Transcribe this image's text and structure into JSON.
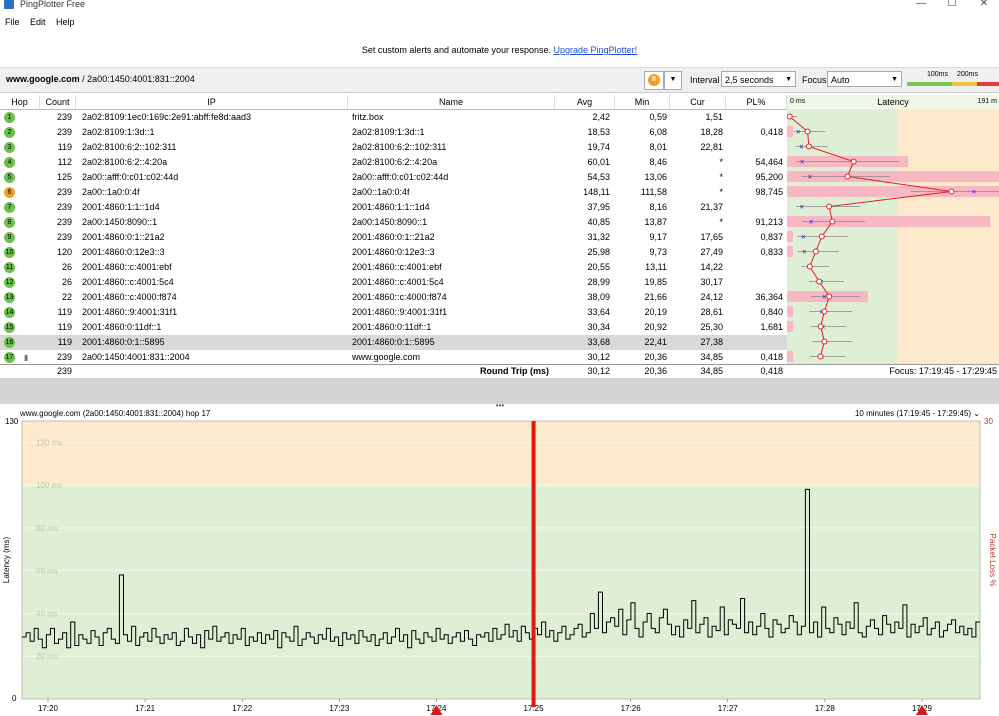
{
  "window": {
    "title": "PingPlotter Free",
    "min": "—",
    "max": "☐",
    "close": "✕"
  },
  "menu": [
    "File",
    "Edit",
    "Help"
  ],
  "banner": {
    "text": "Set custom alerts and automate your response.",
    "link": "Upgrade PingPlotter!"
  },
  "toolbar": {
    "target_host": "www.google.com",
    "target_ip": " / 2a00:1450:4001:831::2004",
    "interval_label": "Interval",
    "interval_value": "2,5 seconds",
    "focus_label": "Focus",
    "focus_value": "Auto",
    "legend_100": "100ms",
    "legend_200": "200ms",
    "pause_icon": "pause-icon"
  },
  "table": {
    "headers": [
      "Hop",
      "Count",
      "IP",
      "Name",
      "Avg",
      "Min",
      "Cur",
      "PL%",
      "0 ms",
      "Latency",
      "191 m"
    ],
    "rows": [
      {
        "hop": "1",
        "count": "239",
        "ip": "2a02:8109:1ec0:169c:2e91:abff:fe8d:aad3",
        "name": "fritz.box",
        "avg": "2,42",
        "min": "0,59",
        "cur": "1,51",
        "pl": ""
      },
      {
        "hop": "2",
        "count": "239",
        "ip": "2a02:8109:1:3d::1",
        "name": "2a02:8109:1:3d::1",
        "avg": "18,53",
        "min": "6,08",
        "cur": "18,28",
        "pl": "0,418"
      },
      {
        "hop": "3",
        "count": "119",
        "ip": "2a02:8100:6:2::102:311",
        "name": "2a02:8100:6:2::102:311",
        "avg": "19,74",
        "min": "8,01",
        "cur": "22,81",
        "pl": ""
      },
      {
        "hop": "4",
        "count": "112",
        "ip": "2a02:8100:6:2::4:20a",
        "name": "2a02:8100:6:2::4:20a",
        "avg": "60,01",
        "min": "8,46",
        "cur": "*",
        "pl": "54,464"
      },
      {
        "hop": "5",
        "count": "125",
        "ip": "2a00::afff:0:c01:c02:44d",
        "name": "2a00::afff:0:c01:c02:44d",
        "avg": "54,53",
        "min": "13,06",
        "cur": "*",
        "pl": "95,200"
      },
      {
        "hop": "6",
        "count": "239",
        "ip": "2a00::1a0:0:4f",
        "name": "2a00::1a0:0:4f",
        "avg": "148,11",
        "min": "111,58",
        "cur": "*",
        "pl": "98,745"
      },
      {
        "hop": "7",
        "count": "239",
        "ip": "2001:4860:1:1::1d4",
        "name": "2001:4860:1:1::1d4",
        "avg": "37,95",
        "min": "8,16",
        "cur": "21,37",
        "pl": ""
      },
      {
        "hop": "8",
        "count": "239",
        "ip": "2a00:1450:8090::1",
        "name": "2a00:1450:8090::1",
        "avg": "40,85",
        "min": "13,87",
        "cur": "*",
        "pl": "91,213"
      },
      {
        "hop": "9",
        "count": "239",
        "ip": "2001:4860:0:1::21a2",
        "name": "2001:4860:0:1::21a2",
        "avg": "31,32",
        "min": "9,17",
        "cur": "17,65",
        "pl": "0,837"
      },
      {
        "hop": "10",
        "count": "120",
        "ip": "2001:4860:0:12e3::3",
        "name": "2001:4860:0:12e3::3",
        "avg": "25,98",
        "min": "9,73",
        "cur": "27,49",
        "pl": "0,833"
      },
      {
        "hop": "11",
        "count": "26",
        "ip": "2001:4860::c:4001:ebf",
        "name": "2001:4860::c:4001:ebf",
        "avg": "20,55",
        "min": "13,11",
        "cur": "14,22",
        "pl": ""
      },
      {
        "hop": "12",
        "count": "26",
        "ip": "2001:4860::c:4001:5c4",
        "name": "2001:4860::c:4001:5c4",
        "avg": "28,99",
        "min": "19,85",
        "cur": "30,17",
        "pl": ""
      },
      {
        "hop": "13",
        "count": "22",
        "ip": "2001:4860::c:4000:f874",
        "name": "2001:4860::c:4000:f874",
        "avg": "38,09",
        "min": "21,66",
        "cur": "24,12",
        "pl": "36,364"
      },
      {
        "hop": "14",
        "count": "119",
        "ip": "2001:4860::9:4001:31f1",
        "name": "2001:4860::9:4001:31f1",
        "avg": "33,64",
        "min": "20,19",
        "cur": "28,61",
        "pl": "0,840"
      },
      {
        "hop": "15",
        "count": "119",
        "ip": "2001:4860:0:11df::1",
        "name": "2001:4860:0:11df::1",
        "avg": "30,34",
        "min": "20,92",
        "cur": "25,30",
        "pl": "1,681"
      },
      {
        "hop": "16",
        "count": "119",
        "ip": "2001:4860:0:1::5895",
        "name": "2001:4860:0:1::5895",
        "avg": "33,68",
        "min": "22,41",
        "cur": "27,38",
        "pl": ""
      },
      {
        "hop": "17",
        "count": "239",
        "ip": "2a00:1450:4001:831::2004",
        "name": "www.google.com",
        "avg": "30,12",
        "min": "20,36",
        "cur": "34,85",
        "pl": "0,418"
      }
    ],
    "summary": {
      "count": "239",
      "label": "Round Trip (ms)",
      "avg": "30,12",
      "min": "20,36",
      "cur": "34,85",
      "pl": "0,418",
      "focus": "Focus: 17:19:45 - 17:29:45"
    }
  },
  "colors": {
    "green_zone": "#dfefd6",
    "orange_zone": "#fde9cc",
    "loss": "#f7b7c3",
    "line": "#e21f26",
    "hop_green": "#6dbf4b",
    "hop_orange": "#f0a020",
    "marker": "#2323d6"
  },
  "chart_header": {
    "left": "www.google.com (2a00:1450:4001:831::2004) hop 17",
    "right": "10 minutes (17:19:45 - 17:29:45)"
  },
  "chart_data": {
    "type": "line",
    "ylabel": "Latency (ms)",
    "y2label": "Packet Loss %",
    "ylim": [
      0,
      130
    ],
    "y2lim": [
      0,
      30
    ],
    "y_axis_ticks": [
      "130",
      "0"
    ],
    "y2_axis_ticks": [
      "30"
    ],
    "grid_labels": [
      "120 ms",
      "100 ms",
      "80 ms",
      "60 ms",
      "40 ms",
      "20 ms"
    ],
    "zones": [
      {
        "from": 0,
        "to": 100,
        "color": "green"
      },
      {
        "from": 100,
        "to": 130,
        "color": "orange"
      }
    ],
    "x_ticks": [
      "17:20",
      "17:21",
      "17:22",
      "17:23",
      "17:24",
      "17:25",
      "17:26",
      "17:27",
      "17:28",
      "17:29"
    ],
    "focus_marker_time": "17:25",
    "loss_markers": [
      "17:24",
      "17:29"
    ],
    "series": [
      {
        "values": [
          29,
          31,
          27,
          33,
          28,
          24,
          30,
          33,
          26,
          28,
          31,
          24,
          36,
          25,
          30,
          28,
          26,
          32,
          29,
          25,
          31,
          33,
          28,
          26,
          58,
          30,
          27,
          34,
          25,
          29,
          31,
          27,
          33,
          29,
          26,
          30,
          28,
          31,
          25,
          27,
          33,
          29,
          26,
          30,
          24,
          32,
          28,
          34,
          27,
          29,
          31,
          26,
          30,
          28,
          33,
          25,
          29,
          27,
          31,
          26,
          30,
          28,
          32,
          24,
          31,
          29,
          27,
          34,
          25,
          28,
          31,
          29,
          26,
          30,
          28,
          33,
          27,
          29,
          25,
          31,
          28,
          30,
          26,
          32,
          29,
          27,
          30,
          25,
          28,
          31,
          26,
          29,
          33,
          27,
          30,
          24,
          32,
          28,
          26,
          31,
          29,
          27,
          33,
          28,
          30,
          26,
          29,
          31,
          27,
          32,
          28,
          25,
          30,
          29,
          31,
          27,
          33,
          28,
          30,
          35,
          29,
          32,
          27,
          34,
          31,
          28,
          33,
          30,
          36,
          29,
          32,
          27,
          31,
          34,
          28,
          30,
          33,
          35,
          29,
          31,
          40,
          33,
          50,
          31,
          36,
          38,
          34,
          42,
          30,
          37,
          45,
          33,
          29,
          36,
          40,
          33,
          31,
          38,
          42,
          35,
          30,
          34,
          29,
          37,
          33,
          46,
          31,
          35,
          38,
          29,
          34,
          32,
          43,
          30,
          37,
          35,
          33,
          47,
          31,
          36,
          30,
          34,
          40,
          33,
          29,
          37,
          35,
          31,
          33,
          39,
          36,
          30,
          34,
          98,
          31,
          36,
          29,
          43,
          33,
          31,
          38,
          35,
          30,
          36,
          33,
          45,
          31,
          29,
          34,
          37,
          33,
          30,
          39,
          35,
          31,
          36,
          33,
          44,
          29,
          35,
          31,
          34,
          38,
          30,
          33,
          36,
          29,
          32,
          35,
          37,
          31,
          34,
          30,
          33,
          29,
          36
        ]
      }
    ]
  }
}
